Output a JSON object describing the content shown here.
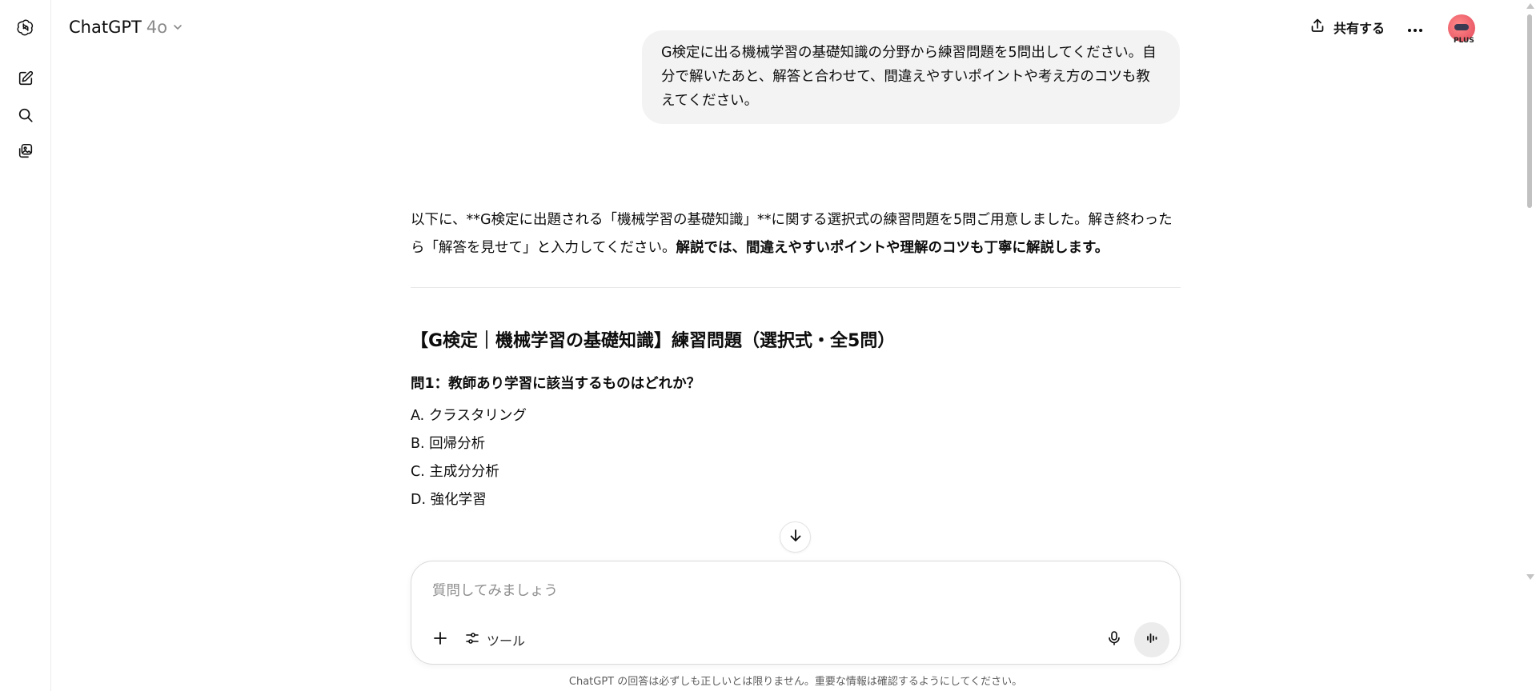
{
  "header": {
    "model_name": "ChatGPT",
    "model_version": "4o",
    "share_label": "共有する",
    "plan_badge": "PLUS"
  },
  "conversation": {
    "user_message": "G検定に出る機械学習の基礎知識の分野から練習問題を5問出してください。自分で解いたあと、解答と合わせて、間違えやすいポイントや考え方のコツも教えてください。",
    "assistant": {
      "intro_plain": "以下に、**G検定に出題される「機械学習の基礎知識」**に関する選択式の練習問題を5問ご用意しました。解き終わったら「解答を見せて」と入力してください。",
      "intro_bold": "解説では、間違えやすいポイントや理解のコツも丁寧に解説します。",
      "section_title": "【G検定｜機械学習の基礎知識】練習問題（選択式・全5問）",
      "question_title": "問1：教師あり学習に該当するものはどれか？",
      "options": [
        "A. クラスタリング",
        "B. 回帰分析",
        "C. 主成分分析",
        "D. 強化学習"
      ]
    }
  },
  "composer": {
    "placeholder": "質問してみましょう",
    "tools_label": "ツール"
  },
  "footer": {
    "disclaimer": "ChatGPT の回答は必ずしも正しいとは限りません。重要な情報は確認するようにしてください。"
  },
  "icons": {
    "rail": [
      "openai-logo-icon",
      "new-chat-icon",
      "search-icon",
      "library-icon"
    ],
    "header": [
      "chevron-down-icon",
      "share-icon",
      "more-icon"
    ],
    "composer": [
      "plus-icon",
      "tools-icon",
      "mic-icon",
      "voice-mode-icon"
    ],
    "scroll": "arrow-down-icon"
  }
}
